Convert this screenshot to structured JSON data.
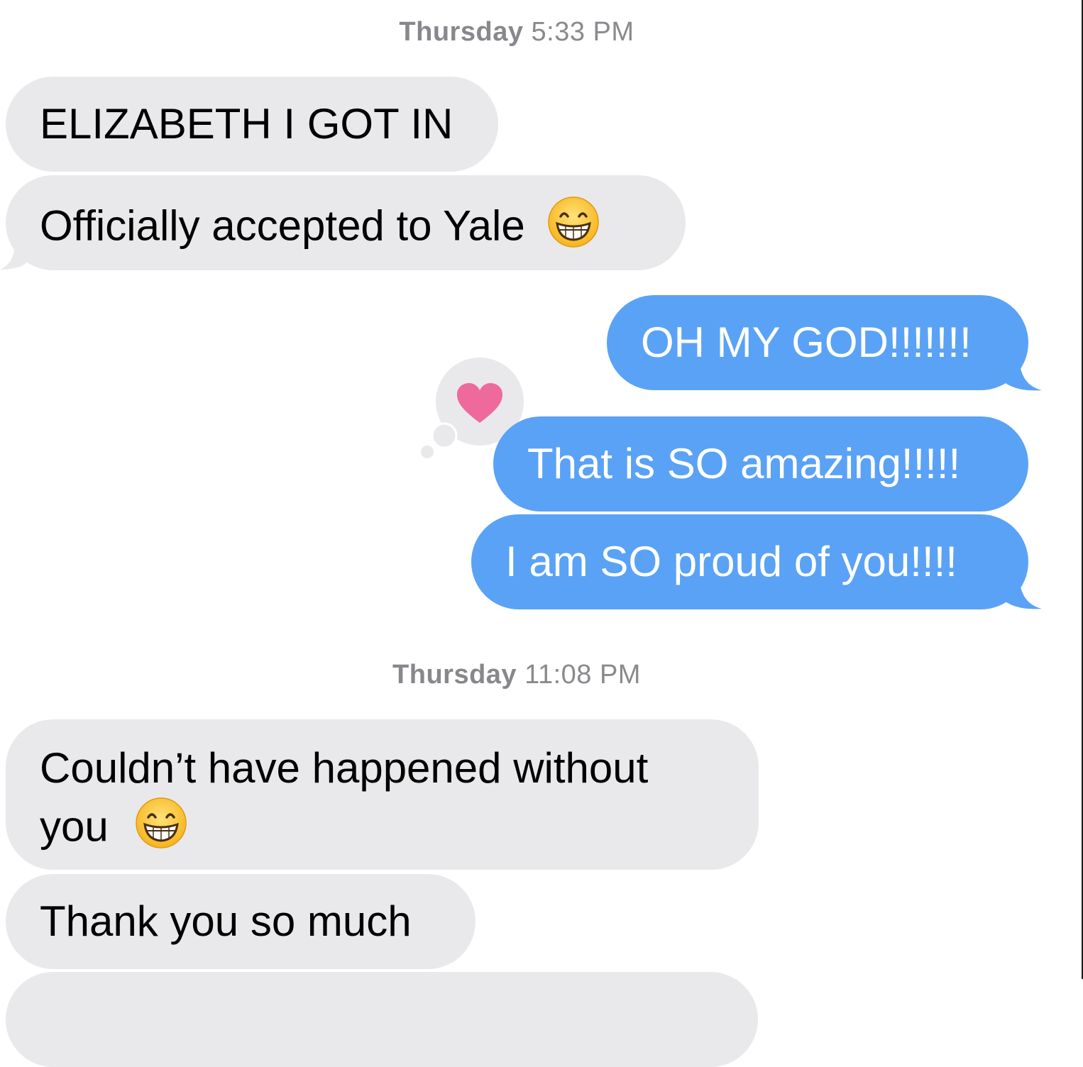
{
  "conversation": {
    "groups": [
      {
        "timestamp": {
          "day": "Thursday",
          "time": "5:33 PM"
        }
      },
      {
        "timestamp": {
          "day": "Thursday",
          "time": "11:08 PM"
        }
      }
    ],
    "messages": [
      {
        "direction": "incoming",
        "text": "ELIZABETH I GOT IN"
      },
      {
        "direction": "incoming",
        "text": "Officially accepted to Yale",
        "emoji": "grinning-face-with-smiling-eyes"
      },
      {
        "direction": "outgoing",
        "text": "OH MY GOD!!!!!!!"
      },
      {
        "direction": "outgoing",
        "text": "That is SO amazing!!!!!",
        "tapback": "heart"
      },
      {
        "direction": "outgoing",
        "text": "I am SO proud of you!!!!"
      },
      {
        "direction": "incoming",
        "text_line1": "Couldn’t have happened without",
        "text_line2": "you",
        "emoji": "grinning-face-with-smiling-eyes"
      },
      {
        "direction": "incoming",
        "text": "Thank you so much"
      }
    ]
  },
  "colors": {
    "incoming_bubble": "#e9e9eb",
    "outgoing_bubble": "#5aa2f5",
    "tapback_heart": "#ee6a9c",
    "timestamp_text": "#8a8a8e"
  }
}
